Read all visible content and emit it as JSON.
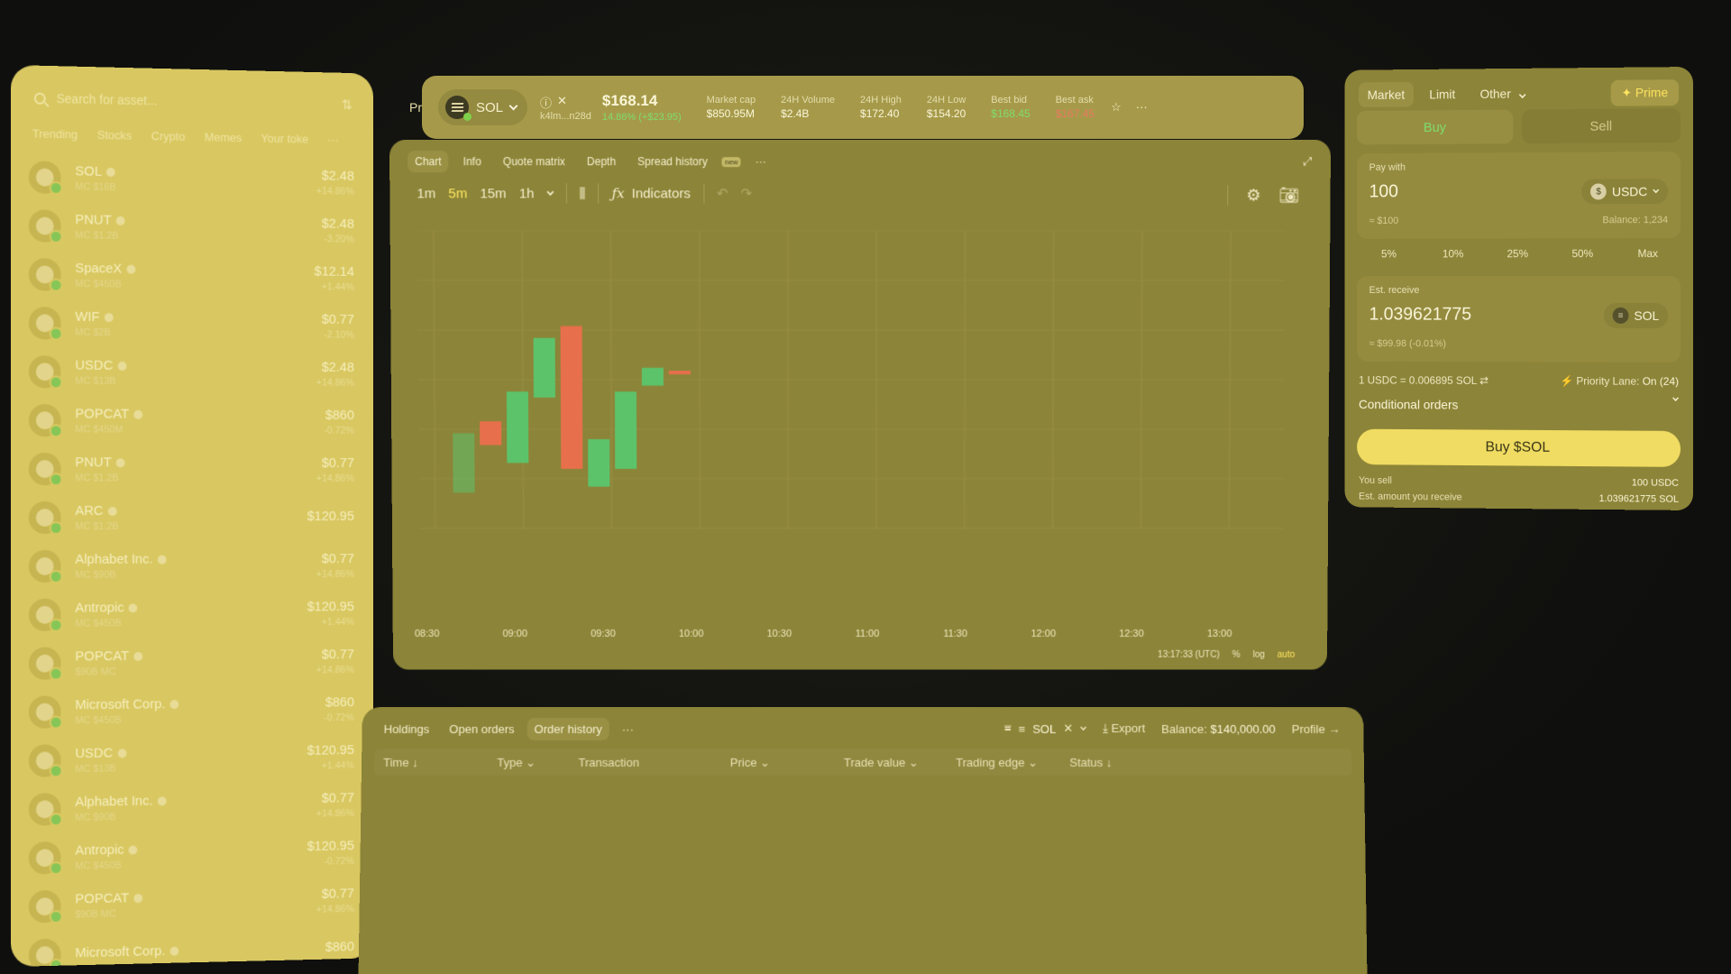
{
  "watchlist": {
    "search_placeholder": "Search for asset...",
    "categories": [
      "Trending",
      "Stocks",
      "Crypto",
      "Memes",
      "Your toke"
    ],
    "more": "···",
    "rows": [
      {
        "name": "SOL",
        "mc": "MC $16B",
        "price": "$2.48",
        "change": "+14.86%"
      },
      {
        "name": "PNUT",
        "mc": "MC $1.2B",
        "price": "$2.48",
        "change": "-3.20%"
      },
      {
        "name": "SpaceX",
        "mc": "MC $450B",
        "price": "$12.14",
        "change": "+1.44%"
      },
      {
        "name": "WIF",
        "mc": "MC $2B",
        "price": "$0.77",
        "change": "-2.10%"
      },
      {
        "name": "USDC",
        "mc": "MC $13B",
        "price": "$2.48",
        "change": "+14.86%"
      },
      {
        "name": "POPCAT",
        "mc": "MC $450M",
        "price": "$860",
        "change": "-0.72%"
      },
      {
        "name": "PNUT",
        "mc": "MC $1.2B",
        "price": "$0.77",
        "change": "+14.86%"
      },
      {
        "name": "ARC",
        "mc": "MC $1.2B",
        "price": "$120.95",
        "change": ""
      },
      {
        "name": "Alphabet Inc.",
        "mc": "MC $90B",
        "price": "$0.77",
        "change": "+14.86%"
      },
      {
        "name": "Antropic",
        "mc": "MC $450B",
        "price": "$120.95",
        "change": "+1.44%"
      },
      {
        "name": "POPCAT",
        "mc": "$90B MC",
        "price": "$0.77",
        "change": "+14.86%"
      },
      {
        "name": "Microsoft Corp.",
        "mc": "MC $450B",
        "price": "$860",
        "change": "-0.72%"
      },
      {
        "name": "USDC",
        "mc": "MC $13B",
        "price": "$120.95",
        "change": "+1.44%"
      },
      {
        "name": "Alphabet Inc.",
        "mc": "MC $90B",
        "price": "$0.77",
        "change": "+14.86%"
      },
      {
        "name": "Antropic",
        "mc": "MC $450B",
        "price": "$120.95",
        "change": "-0.72%"
      },
      {
        "name": "POPCAT",
        "mc": "$90B MC",
        "price": "$0.77",
        "change": "+14.86%"
      },
      {
        "name": "Microsoft Corp.",
        "mc": "",
        "price": "$860",
        "change": ""
      }
    ]
  },
  "ticker": {
    "pr_cut": "Pr",
    "symbol": "SOL",
    "address": "k4lm...n28d",
    "price": "$168.14",
    "change": "14.86% (+$23.95)",
    "stats": [
      {
        "label": "Market cap",
        "value": "$850.95M",
        "tone": "plain"
      },
      {
        "label": "24H Volume",
        "value": "$2.4B",
        "tone": "plain"
      },
      {
        "label": "24H High",
        "value": "$172.40",
        "tone": "plain"
      },
      {
        "label": "24H Low",
        "value": "$154.20",
        "tone": "plain"
      },
      {
        "label": "Best bid",
        "value": "$168.45",
        "tone": "green"
      },
      {
        "label": "Best ask",
        "value": "$167.45",
        "tone": "red"
      }
    ]
  },
  "chart_panel": {
    "tabs": [
      "Chart",
      "Info",
      "Quote matrix",
      "Depth",
      "Spread history"
    ],
    "new_badge": "new",
    "more": "···",
    "timeframes": [
      "1m",
      "5m",
      "15m",
      "1h"
    ],
    "selected_timeframe": "5m",
    "indicators_label": "Indicators",
    "timestamp": "13:17:33 (UTC)",
    "scale_pct": "%",
    "scale_log": "log",
    "scale_auto": "auto",
    "accent": "#ffe460"
  },
  "chart_data": {
    "type": "candlestick",
    "x_labels": [
      "08:30",
      "09:00",
      "09:30",
      "10:00",
      "10:30",
      "11:00",
      "11:30",
      "12:00",
      "12:30",
      "13:00"
    ],
    "candles": [
      {
        "open": 0.12,
        "close": 0.32,
        "up": true
      },
      {
        "open": 0.36,
        "close": 0.28,
        "up": false
      },
      {
        "open": 0.22,
        "close": 0.46,
        "up": true
      },
      {
        "open": 0.44,
        "close": 0.64,
        "up": true
      },
      {
        "open": 0.68,
        "close": 0.2,
        "up": false
      },
      {
        "open": 0.14,
        "close": 0.3,
        "up": true
      },
      {
        "open": 0.2,
        "close": 0.46,
        "up": true
      },
      {
        "open": 0.48,
        "close": 0.54,
        "up": true
      },
      {
        "open": 0.53,
        "close": 0.52,
        "up": false
      }
    ],
    "colors": {
      "up": "#5cc36b",
      "down": "#e86f4c"
    }
  },
  "order": {
    "tabs": [
      "Market",
      "Limit",
      "Other"
    ],
    "prime": "Prime",
    "buy": "Buy",
    "sell": "Sell",
    "pay_label": "Pay with",
    "pay_amount": "100",
    "pay_usd": "≈ $100",
    "balance": "Balance: 1,234",
    "pay_token": "USDC",
    "percents": [
      "5%",
      "10%",
      "25%",
      "50%",
      "Max"
    ],
    "receive_label": "Est. receive",
    "receive_amount": "1.039621775",
    "receive_usd": "≈ $99.98 (-0.01%)",
    "receive_token": "SOL",
    "rate": "1 USDC = 0.006895 SOL ⇄",
    "priority_label": "Priority Lane:",
    "priority_value": "On (24)",
    "conditional": "Conditional orders",
    "cta": "Buy $SOL",
    "you_sell_label": "You sell",
    "you_sell_value": "100 USDC",
    "est_label": "Est. amount you receive",
    "est_value": "1.039621775 SOL"
  },
  "history": {
    "tabs": [
      "Holdings",
      "Open orders",
      "Order history"
    ],
    "active_tab": "Order history",
    "more": "···",
    "filter_token": "SOL",
    "export": "Export",
    "balance_label": "Balance:",
    "balance_value": "$140,000.00",
    "profile": "Profile →",
    "columns": [
      "Time ↓",
      "Type ⌄",
      "Transaction",
      "Price ⌄",
      "Trade value ⌄",
      "Trading edge ⌄",
      "Status ↓"
    ]
  }
}
